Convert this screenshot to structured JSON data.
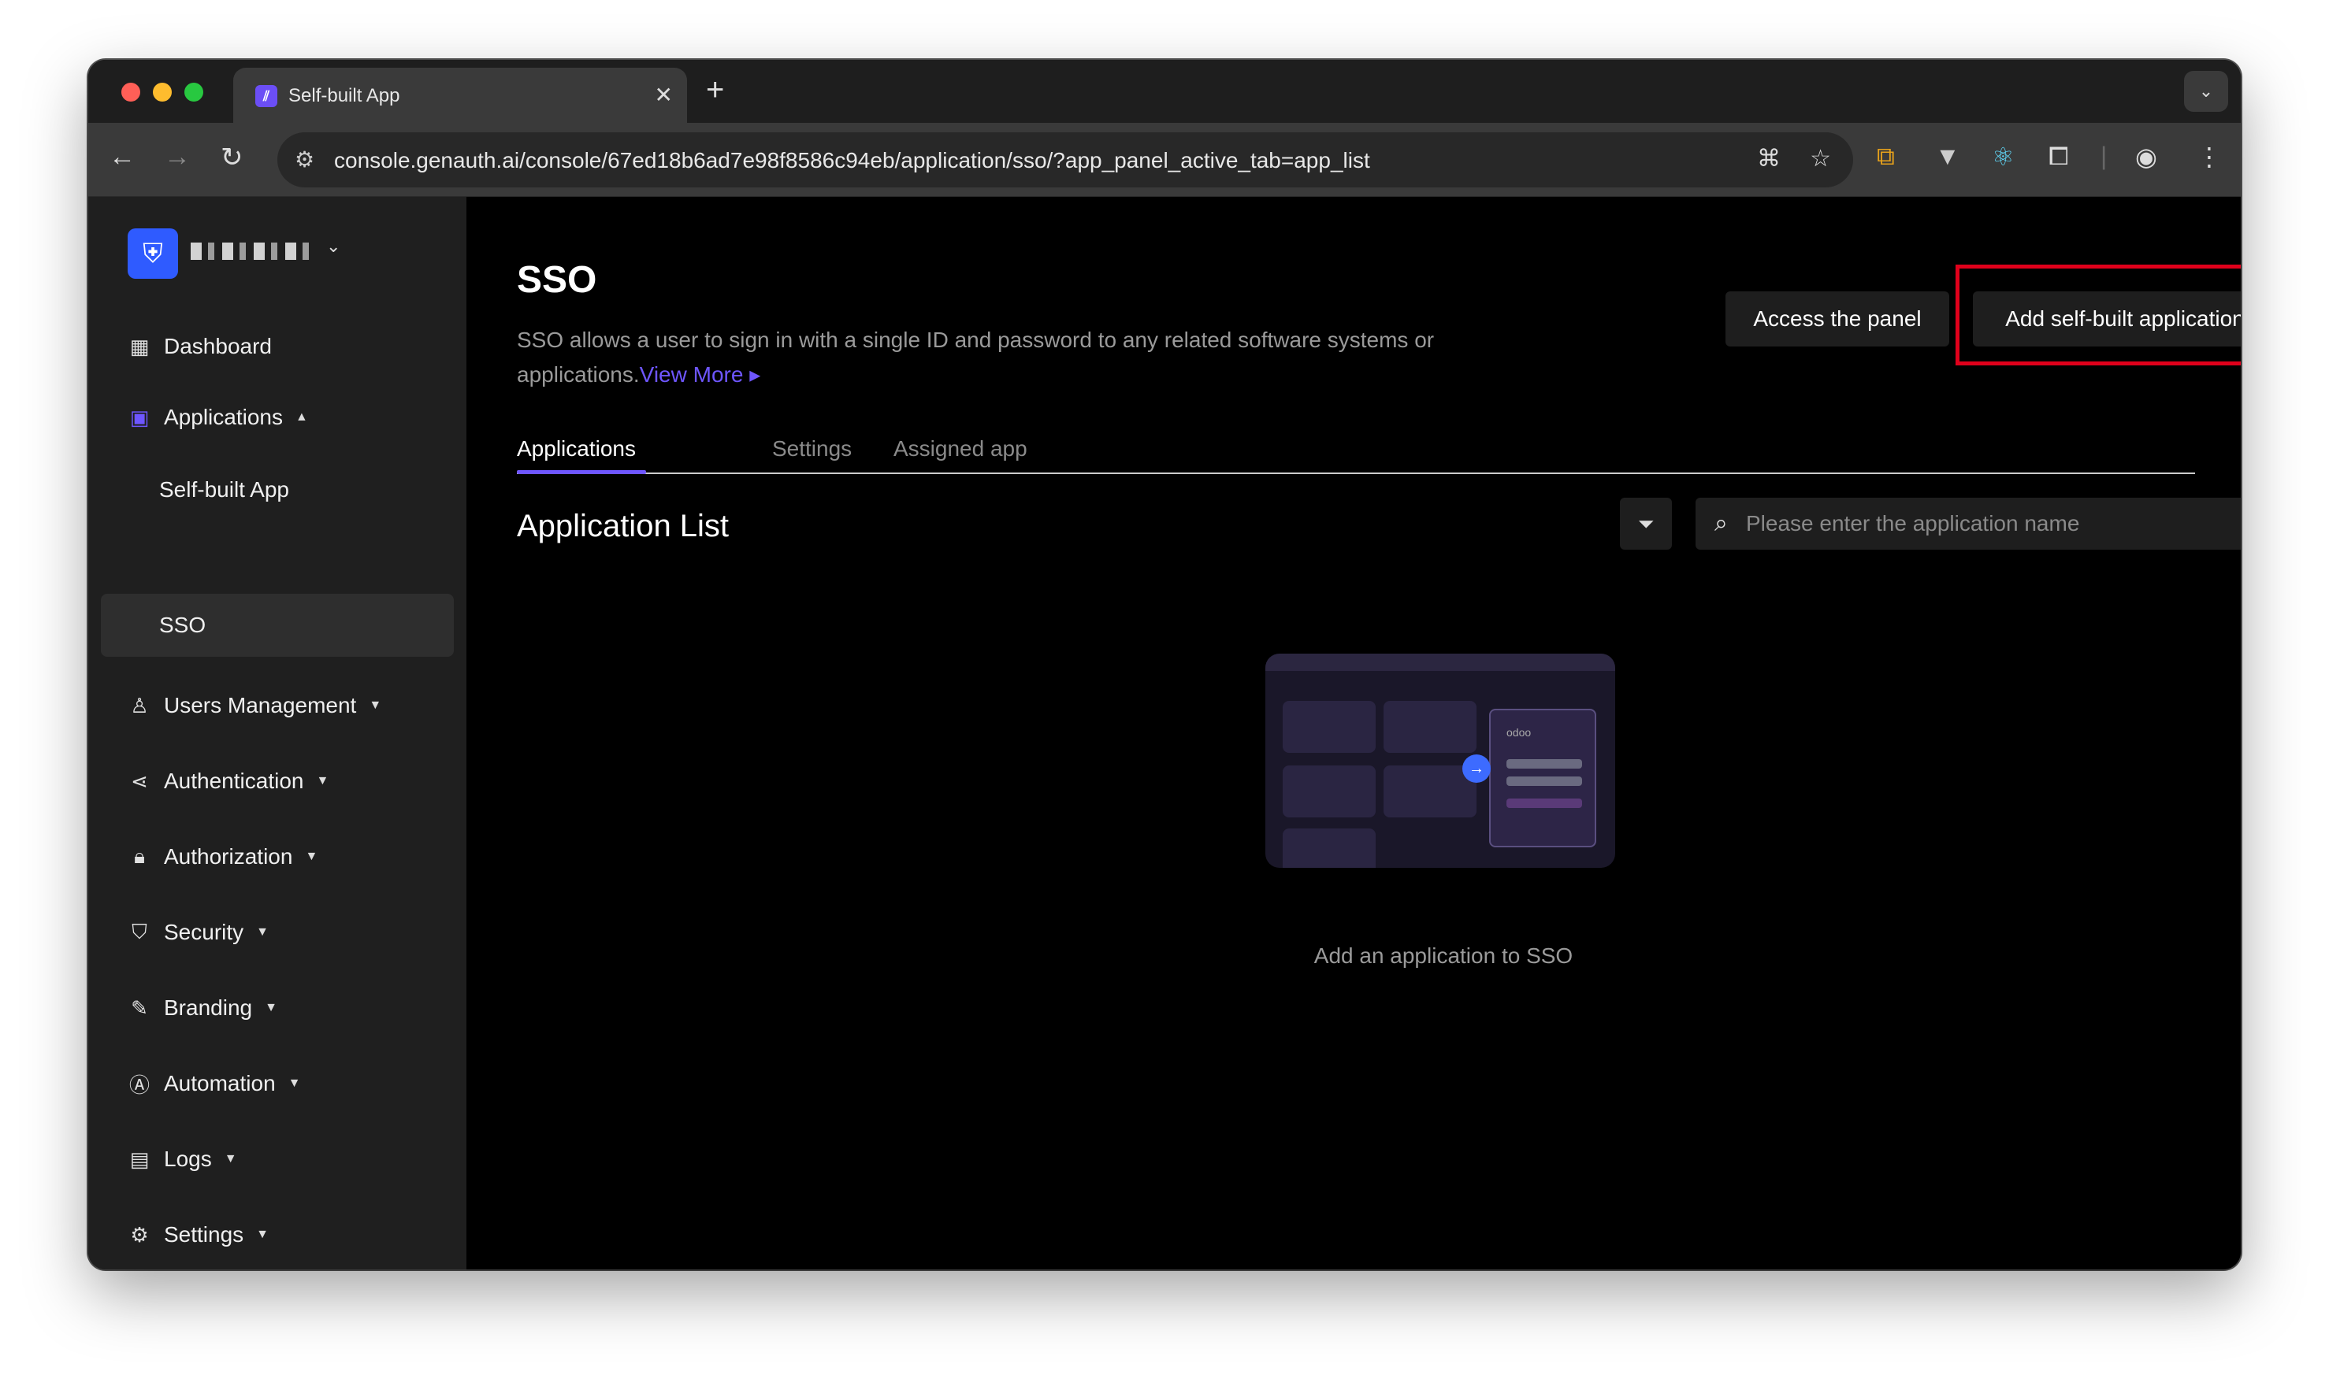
{
  "browser": {
    "tab_title": "Self-built App",
    "url": "console.genauth.ai/console/67ed18b6ad7e98f8586c94eb/application/sso/?app_panel_active_tab=app_list"
  },
  "sidebar": {
    "items": [
      {
        "label": "Dashboard",
        "icon": "dashboard-icon"
      },
      {
        "label": "Applications",
        "icon": "applications-icon"
      },
      {
        "label": "Self-built App"
      },
      {
        "label": "SSO"
      },
      {
        "label": "Users Management",
        "icon": "user-icon"
      },
      {
        "label": "Authentication",
        "icon": "share-icon"
      },
      {
        "label": "Authorization",
        "icon": "lock-icon"
      },
      {
        "label": "Security",
        "icon": "shield-icon"
      },
      {
        "label": "Branding",
        "icon": "brush-icon"
      },
      {
        "label": "Automation",
        "icon": "automation-icon"
      },
      {
        "label": "Logs",
        "icon": "logs-icon"
      },
      {
        "label": "Settings",
        "icon": "gear-icon"
      }
    ]
  },
  "main": {
    "title": "SSO",
    "description": "SSO allows a user to sign in with a single ID and password to any related software systems or applications.",
    "view_more": "View More",
    "btn_access_panel": "Access the panel",
    "btn_add_app": "Add self-built application",
    "tabs": [
      {
        "label": "Applications",
        "active": true
      },
      {
        "label": "Settings",
        "active": false
      },
      {
        "label": "Assigned app",
        "active": false
      }
    ],
    "section_title": "Application List",
    "search_placeholder": "Please enter the application name",
    "empty_text": "Add an application to SSO",
    "illustration_app_label": "odoo"
  },
  "colors": {
    "accent": "#6e56ff",
    "highlight_border": "#e0001b"
  }
}
